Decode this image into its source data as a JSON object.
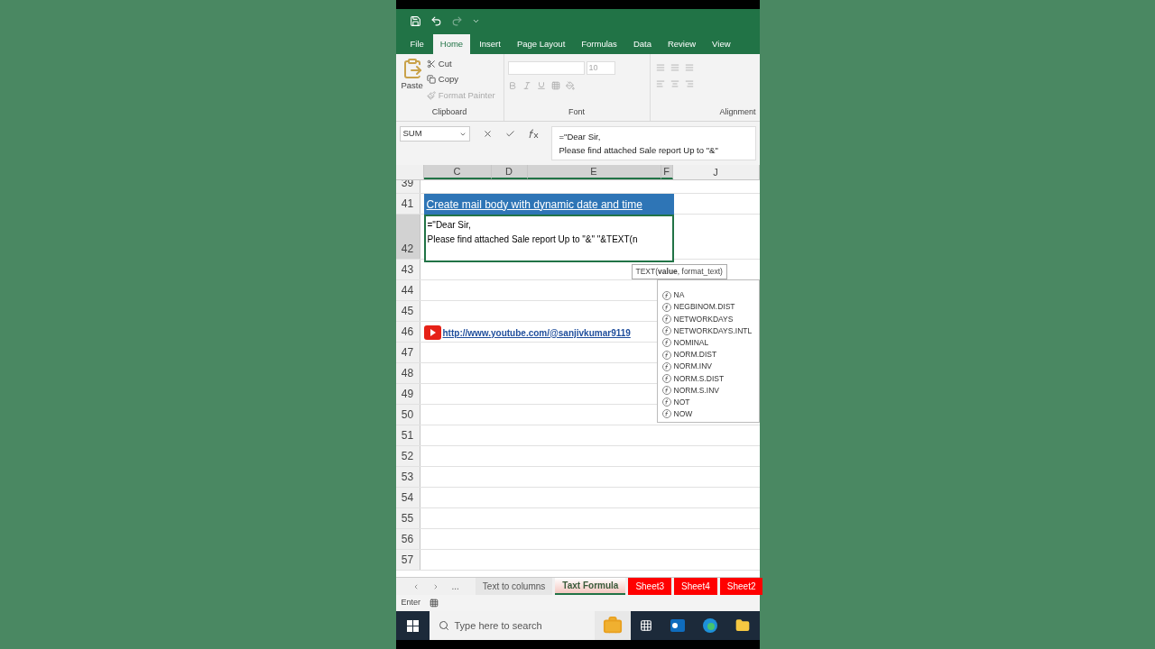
{
  "ribbon_tabs": [
    {
      "label": "File",
      "selected": false
    },
    {
      "label": "Home",
      "selected": true
    },
    {
      "label": "Insert",
      "selected": false
    },
    {
      "label": "Page Layout",
      "selected": false
    },
    {
      "label": "Formulas",
      "selected": false
    },
    {
      "label": "Data",
      "selected": false
    },
    {
      "label": "Review",
      "selected": false
    },
    {
      "label": "View",
      "selected": false
    }
  ],
  "clipboard": {
    "paste": "Paste",
    "cut": "Cut",
    "copy": "Copy",
    "format_painter": "Format Painter",
    "group": "Clipboard"
  },
  "font": {
    "size": "10",
    "group": "Font"
  },
  "alignment": {
    "group": "Alignment"
  },
  "name_box": "SUM",
  "formula_lines": [
    "=\"Dear Sir,",
    "Please find attached Sale report Up to \"&\""
  ],
  "columns": [
    {
      "label": "C",
      "selected": true
    },
    {
      "label": "D",
      "selected": true
    },
    {
      "label": "E",
      "selected": true
    },
    {
      "label": "F",
      "selected": true
    },
    {
      "label": "J",
      "selected": false
    }
  ],
  "rows": [
    {
      "label": "39",
      "selected": false
    },
    {
      "label": "41",
      "selected": false,
      "kind": "title",
      "text": "Create mail body with dynamic date and time"
    },
    {
      "label": "42",
      "selected": true,
      "kind": "editor",
      "lines": [
        "=\"Dear Sir,",
        "Please find attached Sale report Up to \"&\" \"&TEXT(n"
      ]
    },
    {
      "label": "43",
      "selected": false
    },
    {
      "label": "44",
      "selected": false
    },
    {
      "label": "45",
      "selected": false
    },
    {
      "label": "46",
      "selected": false,
      "kind": "link",
      "text": "http://www.youtube.com/@sanjivkumar9119"
    },
    {
      "label": "47",
      "selected": false
    },
    {
      "label": "48",
      "selected": false
    },
    {
      "label": "49",
      "selected": false
    },
    {
      "label": "50",
      "selected": false
    },
    {
      "label": "51",
      "selected": false
    },
    {
      "label": "52",
      "selected": false
    },
    {
      "label": "53",
      "selected": false
    },
    {
      "label": "54",
      "selected": false
    },
    {
      "label": "55",
      "selected": false
    },
    {
      "label": "56",
      "selected": false
    },
    {
      "label": "57",
      "selected": false
    }
  ],
  "tooltip": "TEXT(**value**, format_text)",
  "autocomplete": [
    "NA",
    "NEGBINOM.DIST",
    "NETWORKDAYS",
    "NETWORKDAYS.INTL",
    "NOMINAL",
    "NORM.DIST",
    "NORM.INV",
    "NORM.S.DIST",
    "NORM.S.INV",
    "NOT",
    "NOW"
  ],
  "sheet_nav": "...",
  "sheet_tabs": [
    {
      "label": "Text to columns",
      "selected": false,
      "color": "#e6e6e6"
    },
    {
      "label": "Taxt Formula",
      "selected": true,
      "color": "#f4c7c0"
    },
    {
      "label": "Sheet3",
      "selected": false,
      "color": "#ff0000"
    },
    {
      "label": "Sheet4",
      "selected": false,
      "color": "#ff0000"
    },
    {
      "label": "Sheet2",
      "selected": false,
      "color": "#ff0000"
    }
  ],
  "status": "Enter",
  "taskbar": {
    "search_placeholder": "Type here to search"
  }
}
